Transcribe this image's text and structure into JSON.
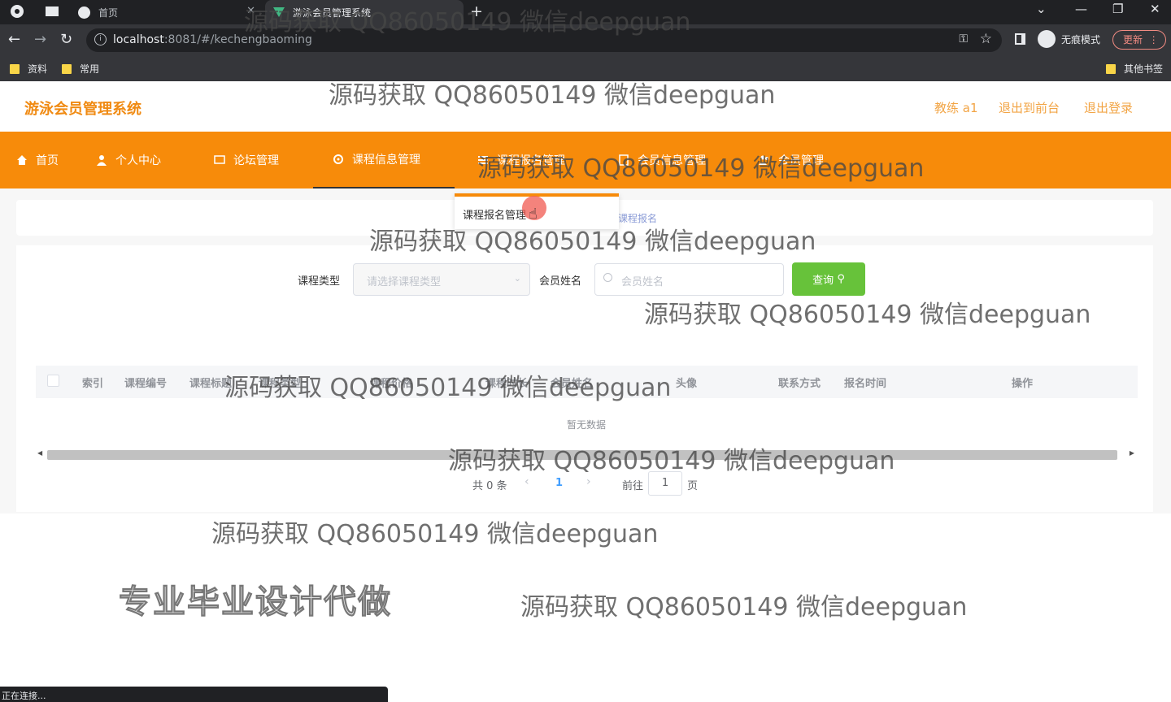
{
  "browser": {
    "tabs": [
      {
        "label": "首页"
      },
      {
        "label": "游泳会员管理系统"
      }
    ],
    "url_host": "localhost",
    "url_rest": ":8081/#/kechengbaoming",
    "profile_label": "无痕模式",
    "update_label": "更新",
    "bookmarks": [
      "资料",
      "常用"
    ],
    "other_bookmarks": "其他书签",
    "status_text": "正在连接..."
  },
  "header": {
    "logo": "游泳会员管理系统",
    "user": "教练 a1",
    "back_to_front": "退出到前台",
    "logout": "退出登录"
  },
  "nav": {
    "items": [
      {
        "label": "首页"
      },
      {
        "label": "个人中心"
      },
      {
        "label": "论坛管理"
      },
      {
        "label": "课程信息管理"
      },
      {
        "label": "课程报名管理"
      },
      {
        "label": "会员信息管理"
      },
      {
        "label": "会员管理"
      }
    ],
    "dropdown_item": "课程报名管理",
    "accent_color": "#f78b0a"
  },
  "breadcrumb": "课程报名",
  "search": {
    "type_label": "课程类型",
    "type_placeholder": "请选择课程类型",
    "name_label": "会员姓名",
    "name_placeholder": "会员姓名",
    "query_button": "查询"
  },
  "table": {
    "columns": [
      "索引",
      "课程编号",
      "课程标题",
      "课程类型",
      "课程价格",
      "课程时长",
      "会员姓名",
      "头像",
      "联系方式",
      "报名时间",
      "操作"
    ],
    "empty_text": "暂无数据"
  },
  "pagination": {
    "total_text": "共 0 条",
    "current_page": "1",
    "goto_label": "前往",
    "goto_value": "1",
    "page_suffix": "页"
  },
  "watermark": "源码获取 QQ86050149 微信deepguan",
  "promo": "专业毕业设计代做"
}
